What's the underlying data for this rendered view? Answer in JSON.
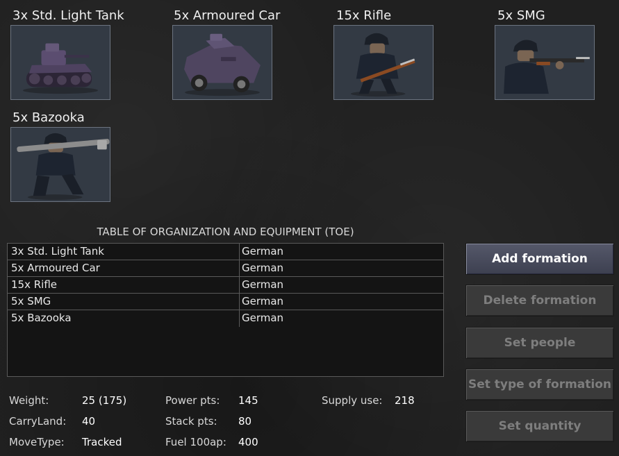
{
  "units": [
    {
      "label": "3x Std. Light Tank",
      "icon": "light-tank-icon"
    },
    {
      "label": "5x Armoured Car",
      "icon": "armoured-car-icon"
    },
    {
      "label": "15x Rifle",
      "icon": "rifleman-icon"
    },
    {
      "label": "5x SMG",
      "icon": "smg-soldier-icon"
    },
    {
      "label": "5x Bazooka",
      "icon": "bazooka-soldier-icon"
    }
  ],
  "toe": {
    "title": "TABLE OF ORGANIZATION AND EQUIPMENT (TOE)",
    "rows": [
      {
        "name": "3x Std. Light Tank",
        "nation": "German"
      },
      {
        "name": "5x Armoured Car",
        "nation": "German"
      },
      {
        "name": "15x Rifle",
        "nation": "German"
      },
      {
        "name": "5x SMG",
        "nation": "German"
      },
      {
        "name": "5x Bazooka",
        "nation": "German"
      }
    ]
  },
  "buttons": {
    "add_formation": "Add formation",
    "delete_formation": "Delete formation",
    "set_people": "Set people",
    "set_type_of_formation": "Set type of formation",
    "set_quantity": "Set quantity"
  },
  "stats": {
    "weight_label": "Weight:",
    "weight_value": "25 (175)",
    "carryland_label": "CarryLand:",
    "carryland_value": "40",
    "movetype_label": "MoveType:",
    "movetype_value": "Tracked",
    "power_label": "Power pts:",
    "power_value": "145",
    "stack_label": "Stack pts:",
    "stack_value": "80",
    "fuel_label": "Fuel 100ap:",
    "fuel_value": "400",
    "supply_label": "Supply use:",
    "supply_value": "218"
  }
}
